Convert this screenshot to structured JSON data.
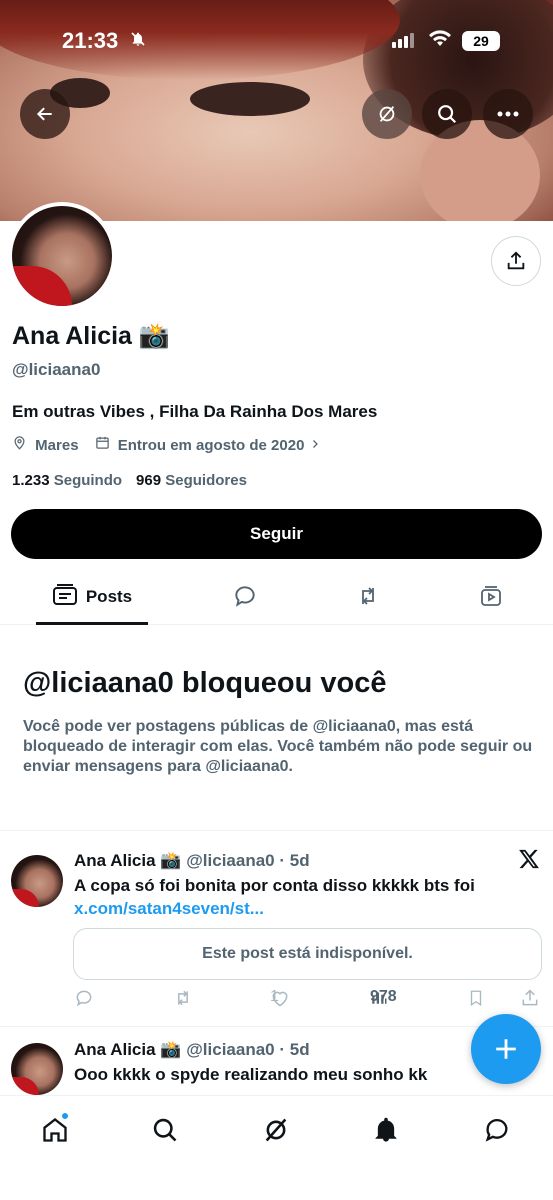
{
  "status_bar": {
    "time": "21:33",
    "battery": "29"
  },
  "profile": {
    "name": "Ana Alicia",
    "name_emoji": "📸",
    "handle": "@liciaana0",
    "bio": "Em outras Vibes , Filha Da Rainha Dos Mares",
    "location": "Mares",
    "joined": "Entrou em agosto de 2020",
    "following_count": "1.233",
    "following_label": "Seguindo",
    "followers_count": "969",
    "followers_label": "Seguidores",
    "follow_button": "Seguir"
  },
  "tabs": {
    "posts": "Posts"
  },
  "blocked": {
    "title": "@liciaana0 bloqueou você",
    "message": "Você pode ver postagens públicas de @liciaana0, mas está bloqueado de interagir com elas. Você também não pode seguir ou enviar mensagens para @liciaana0."
  },
  "posts": [
    {
      "name": "Ana Alicia",
      "emoji": "📸",
      "handle": "@liciaana0",
      "time": "· 5d",
      "text": "A copa só foi bonita por conta disso kkkkk bts foi",
      "link": "x.com/satan4seven/st...",
      "unavailable": "Este post está indisponível.",
      "likes": "1",
      "views": "978"
    },
    {
      "name": "Ana Alicia",
      "emoji": "📸",
      "handle": "@liciaana0",
      "time": "· 5d",
      "text": "Ooo kkkk o spyde realizando meu sonho kk"
    }
  ],
  "colors": {
    "accent": "#1d9bf0",
    "muted": "#536471",
    "text": "#0f1419"
  }
}
